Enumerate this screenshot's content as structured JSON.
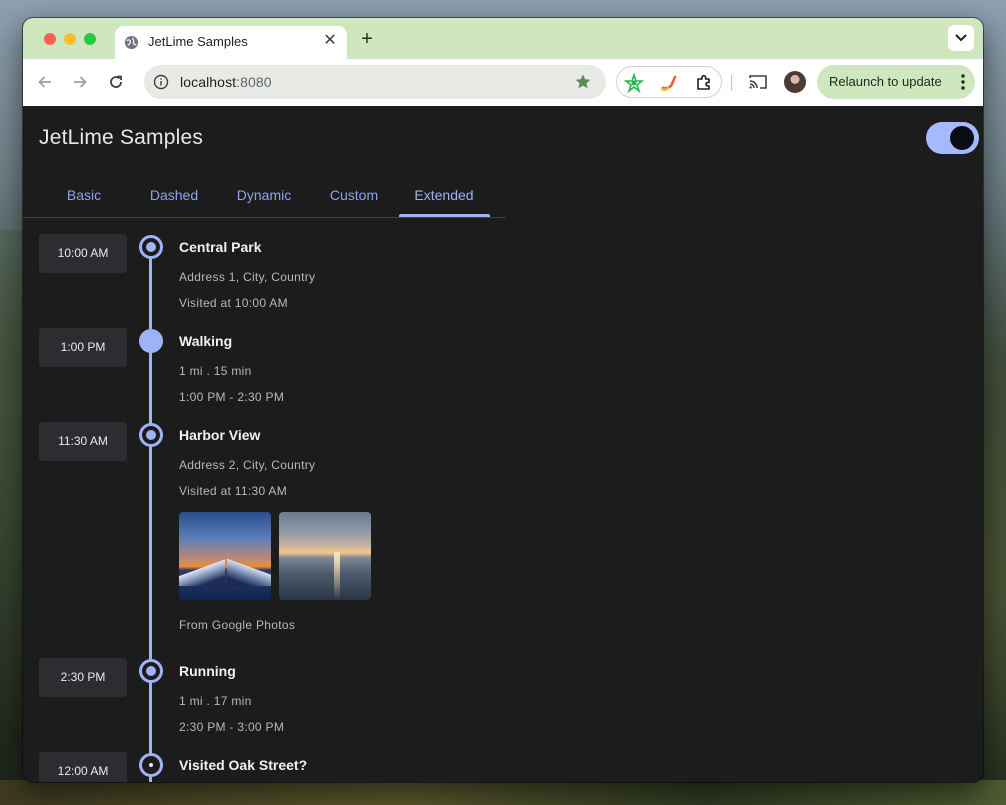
{
  "browser": {
    "tab_title": "JetLime Samples",
    "url_host": "localhost",
    "url_port": ":8080",
    "relaunch_label": "Relaunch to update",
    "icons": [
      "globe-icon",
      "close-icon",
      "plus-icon",
      "chevron-down-icon",
      "back-arrow-icon",
      "forward-arrow-icon",
      "reload-icon",
      "info-icon",
      "star-icon",
      "extension-puzzle-icon",
      "cast-icon",
      "more-vert-icon"
    ],
    "accent": "#cfe7bf"
  },
  "app": {
    "title": "JetLime Samples",
    "dark_mode": true,
    "accent": "#9eb2f5",
    "tabs": [
      {
        "label": "Basic"
      },
      {
        "label": "Dashed"
      },
      {
        "label": "Dynamic"
      },
      {
        "label": "Custom"
      },
      {
        "label": "Extended"
      }
    ],
    "active_tab": "Extended"
  },
  "timeline": {
    "events": [
      {
        "time": "10:00 AM",
        "title": "Central Park",
        "lines": [
          "Address 1, City, Country",
          "Visited at 10:00 AM"
        ]
      },
      {
        "time": "1:00 PM",
        "title": "Walking",
        "lines": [
          "1 mi . 15 min",
          "1:00 PM - 2:30 PM"
        ]
      },
      {
        "time": "11:30 AM",
        "title": "Harbor View",
        "lines": [
          "Address 2, City, Country",
          "Visited at 11:30 AM"
        ],
        "photos_caption": "From Google Photos"
      },
      {
        "time": "2:30 PM",
        "title": "Running",
        "lines": [
          "1 mi . 17 min",
          "2:30 PM - 3:00 PM"
        ]
      },
      {
        "time": "12:00 AM",
        "title": "Visited Oak Street?",
        "lines": []
      }
    ]
  }
}
